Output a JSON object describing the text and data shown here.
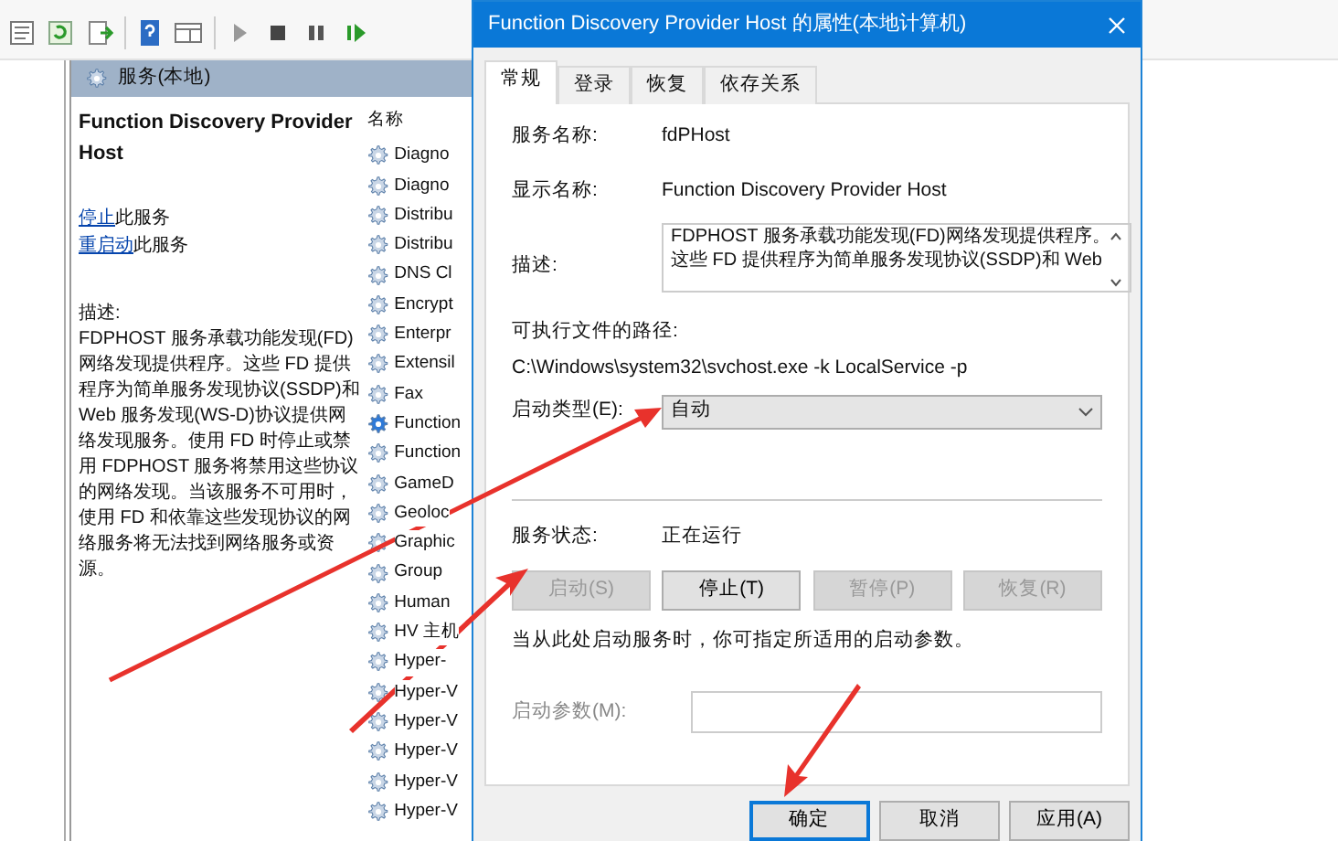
{
  "services": {
    "header": "服务(本地)",
    "detail": {
      "title": "Function Discovery Provider Host",
      "actions": [
        {
          "link": "停止",
          "text": "此服务"
        },
        {
          "link": "重启动",
          "text": "此服务"
        }
      ],
      "description_label": "描述:",
      "description": "FDPHOST 服务承载功能发现(FD)网络发现提供程序。这些 FD 提供程序为简单服务发现协议(SSDP)和 Web 服务发现(WS-D)协议提供网络发现服务。使用 FD 时停止或禁用 FDPHOST 服务将禁用这些协议的网络发现。当该服务不可用时，使用 FD 和依靠这些发现协议的网络服务将无法找到网络服务或资源。"
    },
    "list": {
      "column": "名称",
      "items": [
        {
          "name": "Diagno",
          "selected": false
        },
        {
          "name": "Diagno",
          "selected": false
        },
        {
          "name": "Distribu",
          "selected": false
        },
        {
          "name": "Distribu",
          "selected": false
        },
        {
          "name": "DNS Cl",
          "selected": false
        },
        {
          "name": "Encrypt",
          "selected": false
        },
        {
          "name": "Enterpr",
          "selected": false
        },
        {
          "name": "Extensil",
          "selected": false
        },
        {
          "name": "Fax",
          "selected": false
        },
        {
          "name": "Function",
          "selected": true
        },
        {
          "name": "Function",
          "selected": false
        },
        {
          "name": "GameD",
          "selected": false
        },
        {
          "name": "Geoloc",
          "selected": false
        },
        {
          "name": "Graphic",
          "selected": false
        },
        {
          "name": "Group",
          "selected": false
        },
        {
          "name": "Human",
          "selected": false
        },
        {
          "name": "HV 主机",
          "selected": false
        },
        {
          "name": "Hyper-",
          "selected": false
        },
        {
          "name": "Hyper-V",
          "selected": false
        },
        {
          "name": "Hyper-V",
          "selected": false
        },
        {
          "name": "Hyper-V",
          "selected": false
        },
        {
          "name": "Hyper-V",
          "selected": false
        },
        {
          "name": "Hyper-V",
          "selected": false
        }
      ]
    }
  },
  "dialog": {
    "title": "Function Discovery Provider Host 的属性(本地计算机)",
    "tabs": [
      {
        "label": "常规",
        "selected": true
      },
      {
        "label": "登录",
        "selected": false
      },
      {
        "label": "恢复",
        "selected": false
      },
      {
        "label": "依存关系",
        "selected": false
      }
    ],
    "service_name": {
      "label": "服务名称:",
      "value": "fdPHost"
    },
    "display_name": {
      "label": "显示名称:",
      "value": "Function Discovery Provider Host"
    },
    "description": {
      "label": "描述:",
      "lines": [
        "FDPHOST 服务承载功能发现(FD)网络发现提供程序。",
        "这些 FD 提供程序为简单服务发现协议(SSDP)和 Web"
      ]
    },
    "path": {
      "label": "可执行文件的路径:",
      "value": "C:\\Windows\\system32\\svchost.exe -k LocalService -p"
    },
    "startup_type": {
      "label": "启动类型(E):",
      "value": "自动"
    },
    "status": {
      "label": "服务状态:",
      "value": "正在运行"
    },
    "control_buttons": [
      {
        "label": "启动(S)",
        "disabled": true
      },
      {
        "label": "停止(T)",
        "disabled": false
      },
      {
        "label": "暂停(P)",
        "disabled": true
      },
      {
        "label": "恢复(R)",
        "disabled": true
      }
    ],
    "note": "当从此处启动服务时，你可指定所适用的启动参数。",
    "parameters": {
      "label": "启动参数(M):",
      "disabled": true
    },
    "buttons": [
      {
        "label": "确定",
        "default": true
      },
      {
        "label": "取消",
        "default": false
      },
      {
        "label": "应用(A)",
        "default": false
      }
    ]
  }
}
